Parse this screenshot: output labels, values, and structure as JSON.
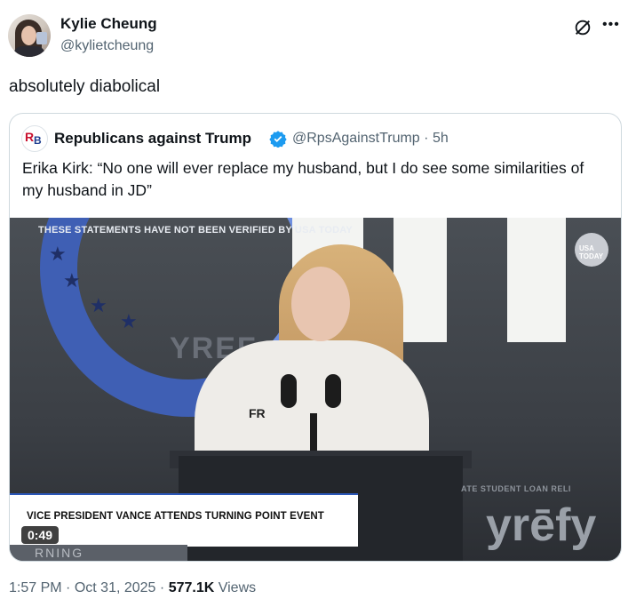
{
  "author": {
    "name": "Kylie Cheung",
    "handle": "@kylietcheung"
  },
  "tweet": {
    "text": "absolutely diabolical",
    "time": "1:57 PM",
    "date": "Oct 31, 2025",
    "views_count": "577.1K",
    "views_label": "Views",
    "separator": "·"
  },
  "quoted": {
    "avatar_letters": [
      "R",
      "B"
    ],
    "name": "Republicans against Trump",
    "handle": "@RpsAgainstTrump",
    "age": "5h",
    "text": "Erika Kirk: “No one will ever replace my husband, but I do see some similarities of my husband in JD”",
    "video": {
      "disclaimer": "THESE STATEMENTS HAVE NOT BEEN VERIFIED BY USA TODAY",
      "headline": "VICE PRESIDENT VANCE ATTENDS TURNING POINT EVENT",
      "duration": "0:49",
      "backdrop_text": "YREF",
      "sponsor_text": "yrēfy",
      "banner_right": "ATE STUDENT LOAN RELI",
      "podium_text": "RNING",
      "shirt_text": "FR",
      "logo_text": "USA TODAY"
    }
  },
  "icons": {
    "grok": "grok-icon",
    "more": "more-icon",
    "verified": "verified-badge-icon"
  },
  "colors": {
    "verified_blue": "#1d9bf0",
    "secondary_text": "#536471"
  }
}
